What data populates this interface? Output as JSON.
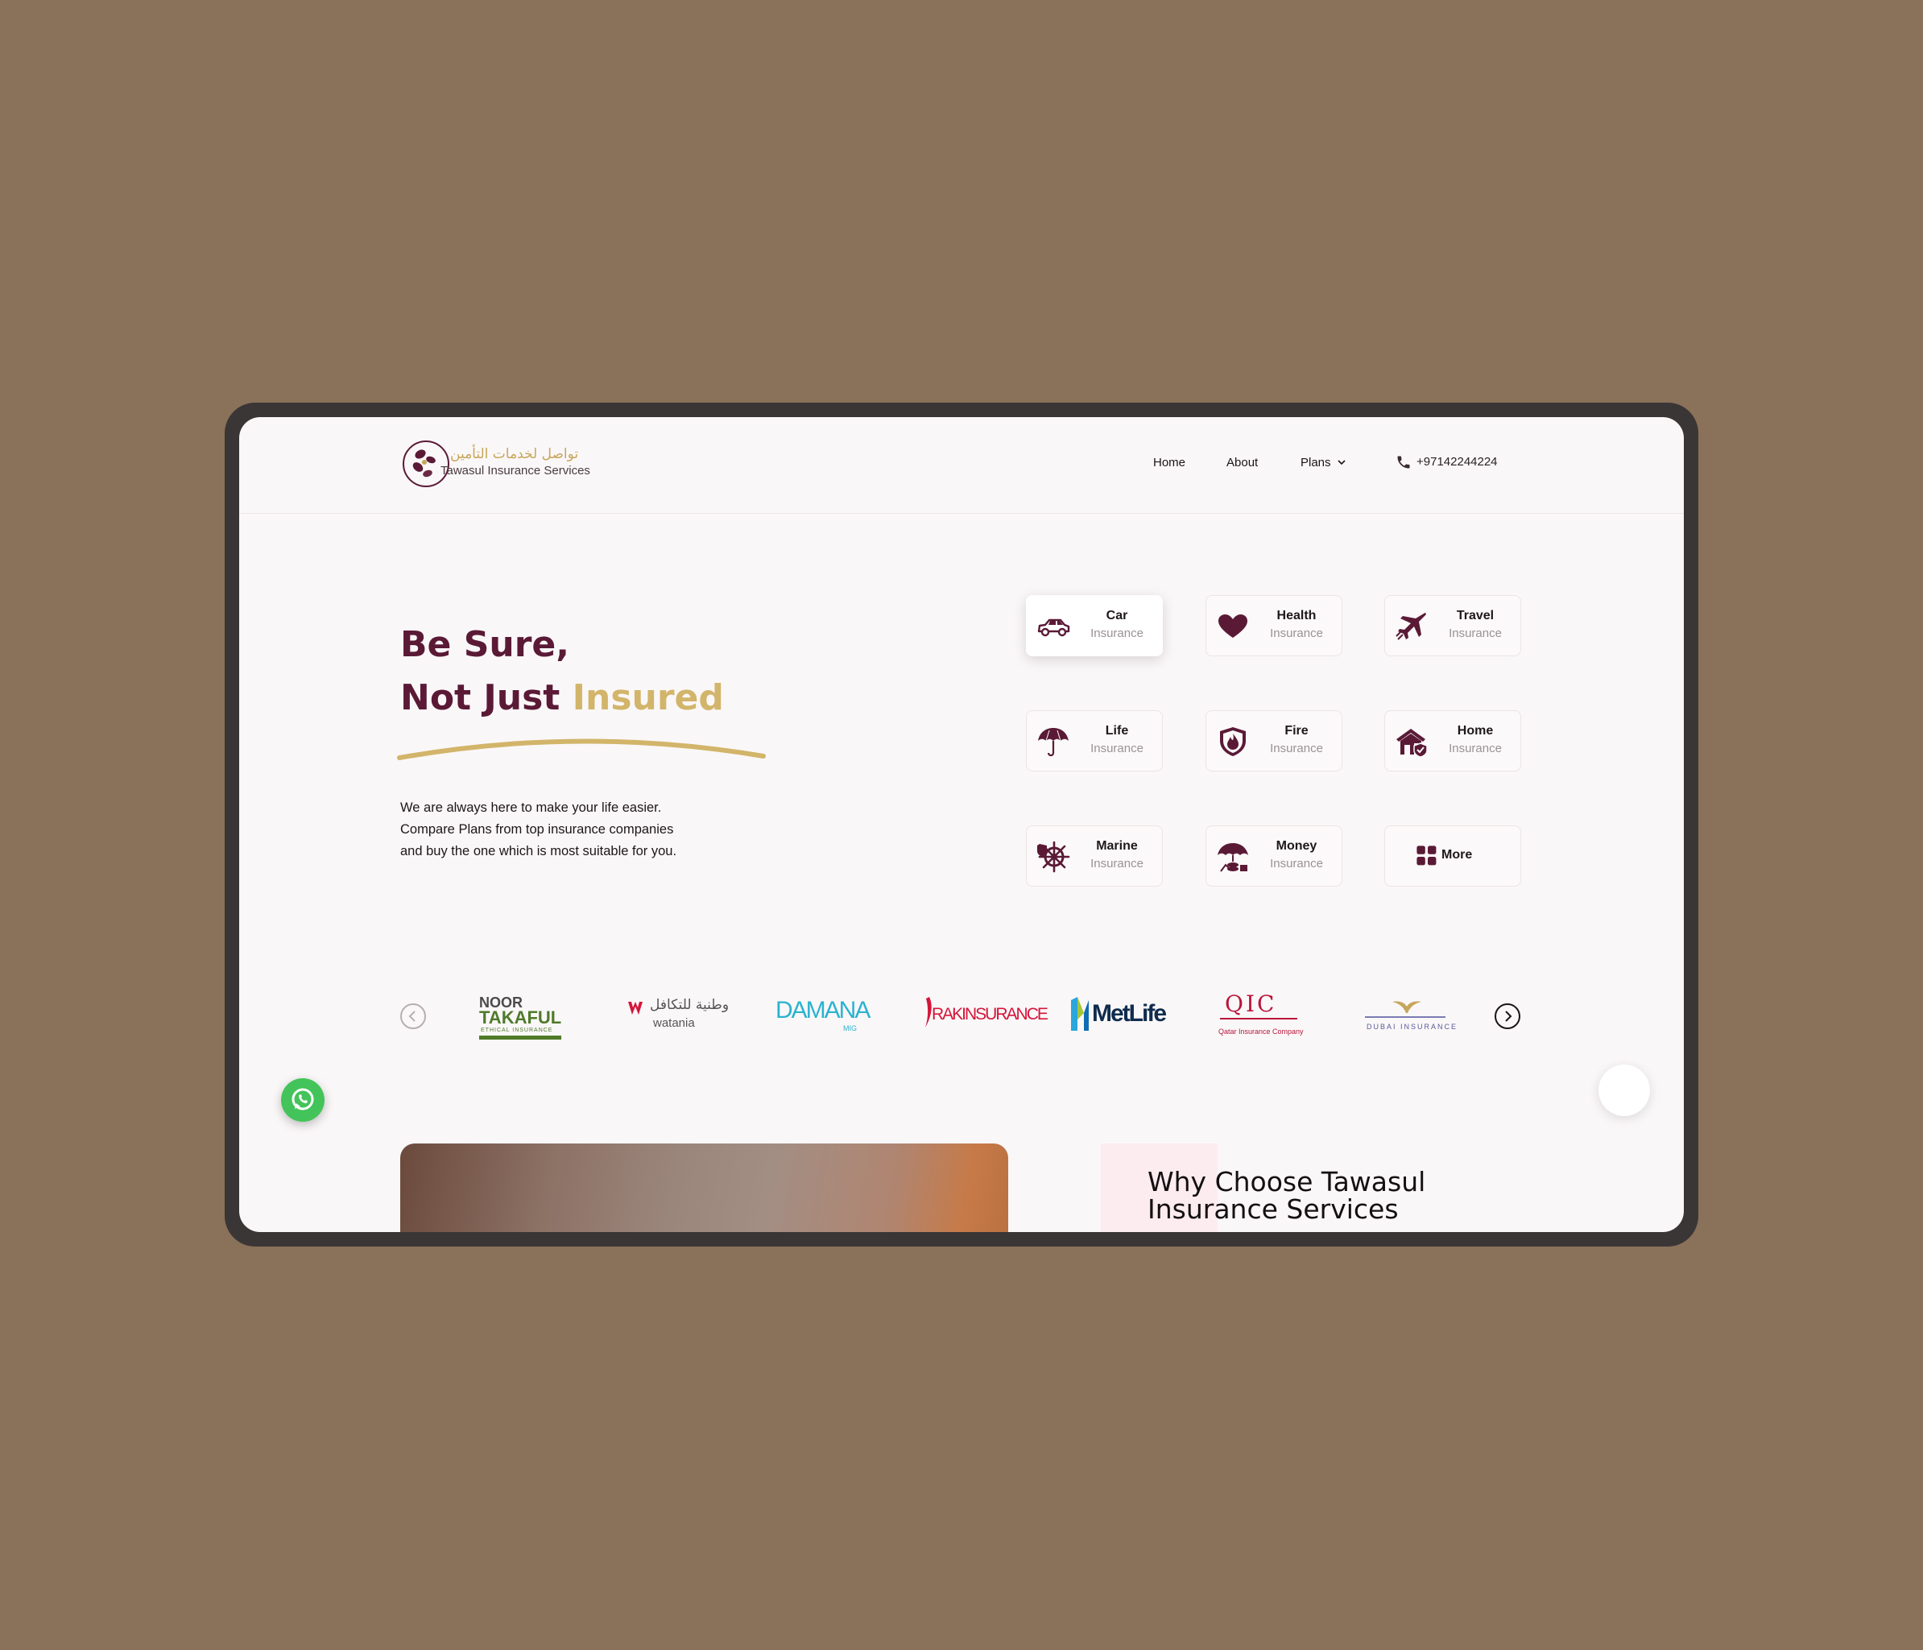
{
  "logo": {
    "arabic": "تواصل لخدمات التأمين",
    "english": "Tawasul Insurance Services"
  },
  "nav": {
    "home": "Home",
    "about": "About",
    "plans": "Plans",
    "phone": "+97142244224"
  },
  "hero": {
    "title_line1": "Be Sure,",
    "title_line2_a": "Not Just ",
    "title_line2_b": "Insured",
    "text_line1": "We are always here to make your life easier.",
    "text_line2": "Compare Plans from top insurance companies",
    "text_line3": "and buy the one which is most suitable for you."
  },
  "cards": [
    {
      "title": "Car",
      "subtitle": "Insurance",
      "icon": "car-icon"
    },
    {
      "title": "Health",
      "subtitle": "Insurance",
      "icon": "heart-icon"
    },
    {
      "title": "Travel",
      "subtitle": "Insurance",
      "icon": "airplane-icon"
    },
    {
      "title": "Life",
      "subtitle": "Insurance",
      "icon": "umbrella-icon"
    },
    {
      "title": "Fire",
      "subtitle": "Insurance",
      "icon": "fire-shield-icon"
    },
    {
      "title": "Home",
      "subtitle": "Insurance",
      "icon": "house-shield-icon"
    },
    {
      "title": "Marine",
      "subtitle": "Insurance",
      "icon": "ship-wheel-icon"
    },
    {
      "title": "Money",
      "subtitle": "Insurance",
      "icon": "money-umbrella-icon"
    },
    {
      "title": "More",
      "icon": "grid-icon"
    }
  ],
  "partners": {
    "noor_a": "NOOR",
    "noor_b": "TAKAFUL",
    "noor_c": "ETHICAL INSURANCE",
    "watania_ar": "وطنية للتكافل",
    "watania_en": "watania",
    "damana": "DAMANA",
    "damana_sub": "MIG",
    "rak": "RAKINSURANCE",
    "metlife": "MetLife",
    "qic": "QIC",
    "qic_sub": "Qatar Insurance Company",
    "dubai": "DUBAI INSURANCE"
  },
  "why": {
    "line1": "Why Choose Tawasul",
    "line2": "Insurance Services"
  },
  "colors": {
    "brand": "#5a1a36",
    "gold": "#d2b56a",
    "background": "#8a7159"
  }
}
